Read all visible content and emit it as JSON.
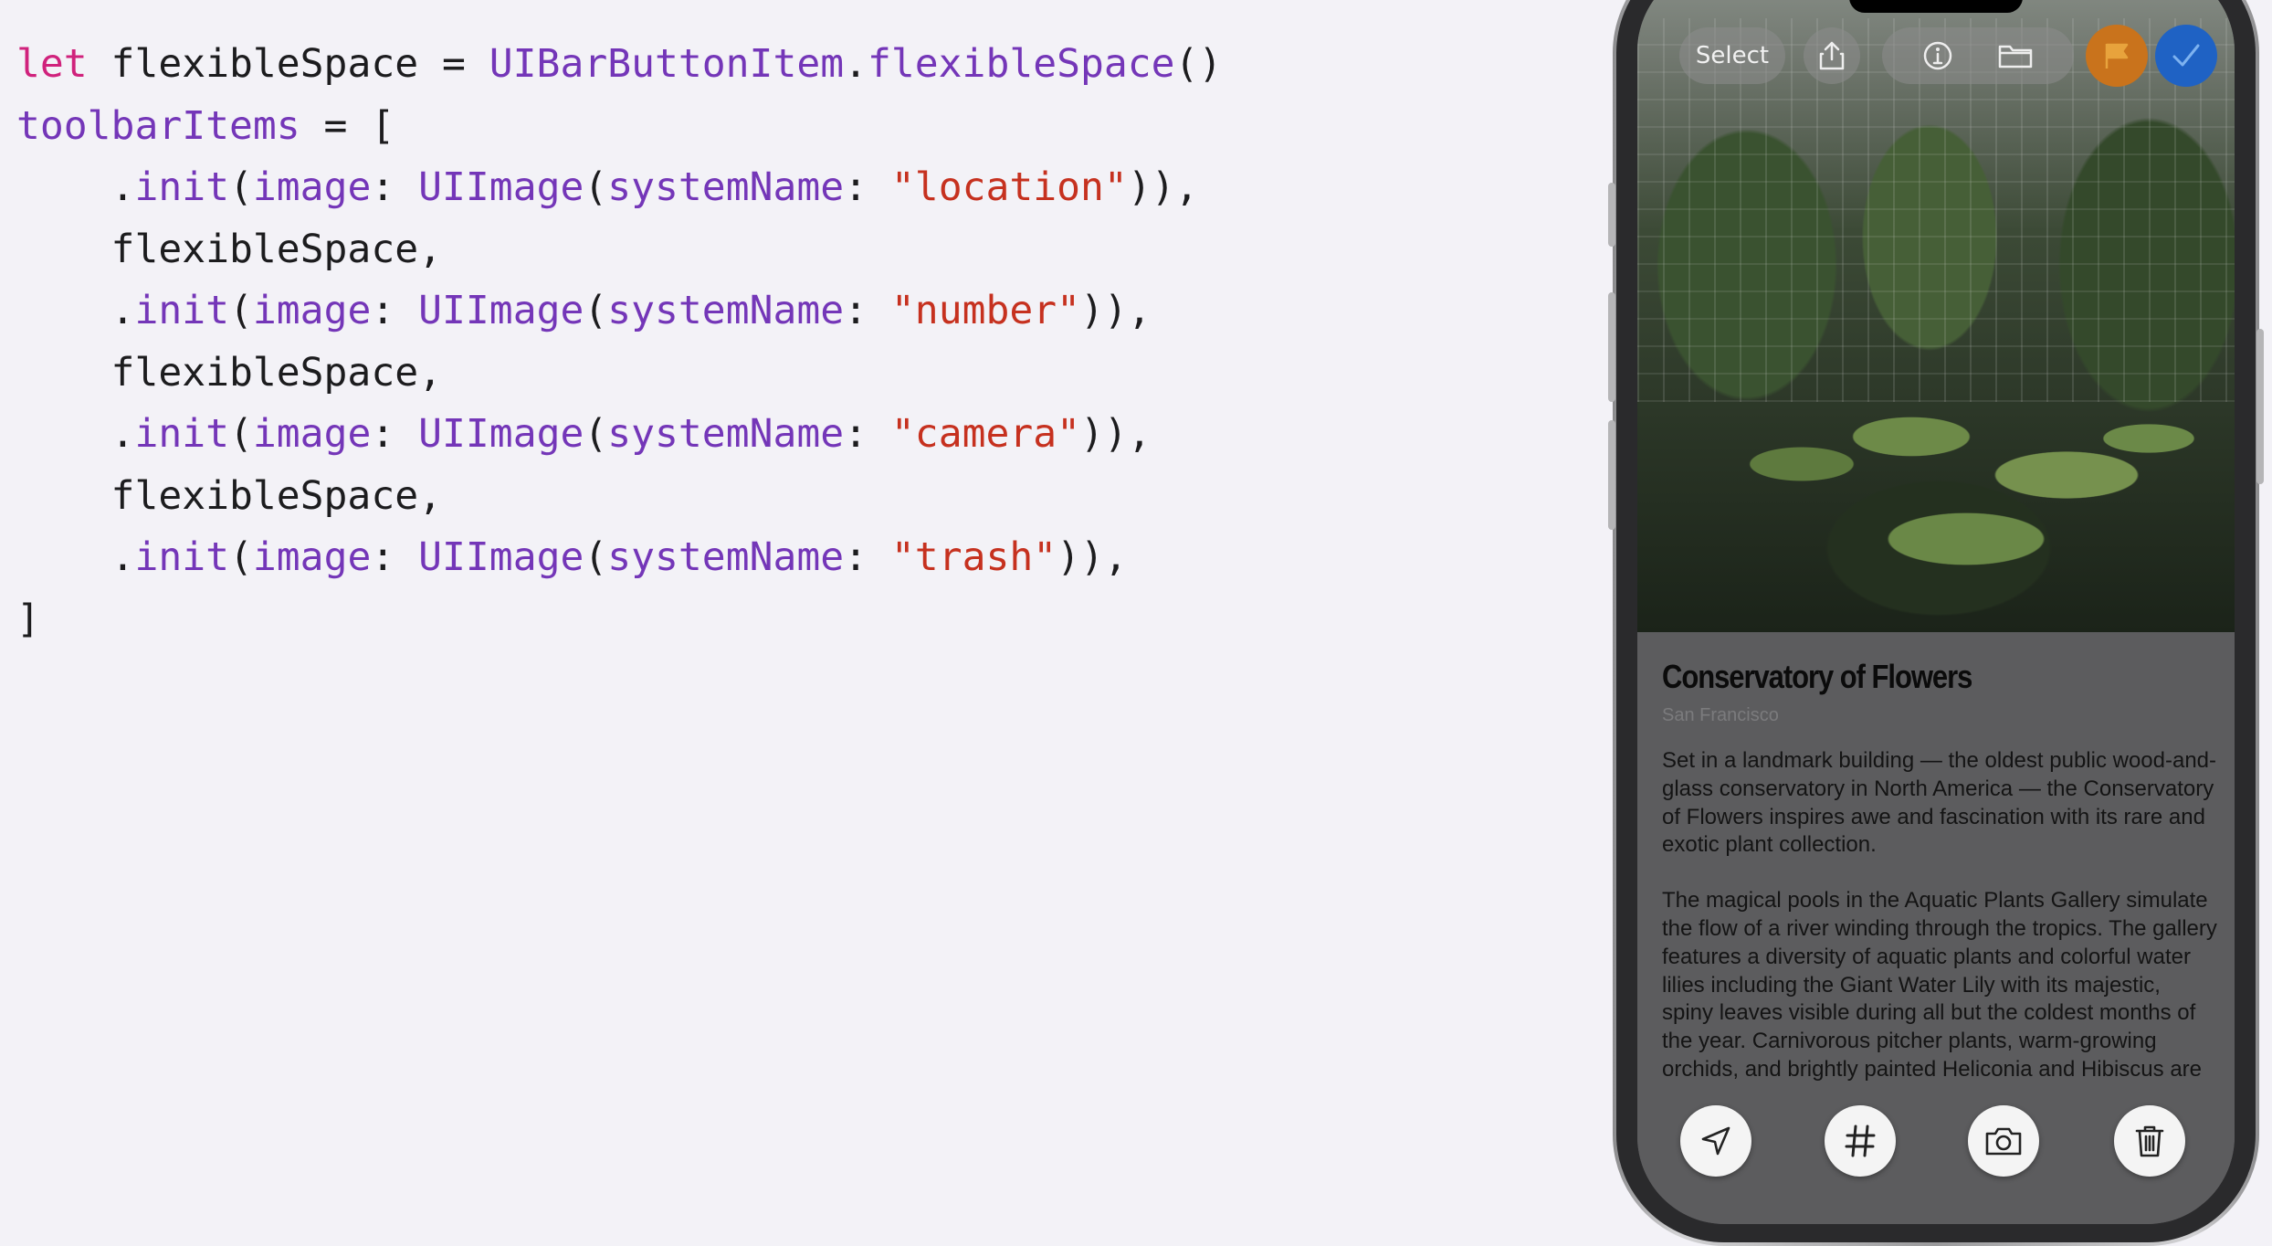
{
  "code_lines": [
    [
      {
        "t": "let",
        "c": "kw"
      },
      {
        "t": " flexibleSpace = ",
        "c": "pl"
      },
      {
        "t": "UIBarButtonItem",
        "c": "ty"
      },
      {
        "t": ".",
        "c": "pl"
      },
      {
        "t": "flexibleSpace",
        "c": "mb"
      },
      {
        "t": "()",
        "c": "pl"
      }
    ],
    [
      {
        "t": "toolbarItems",
        "c": "mb"
      },
      {
        "t": " = [",
        "c": "pl"
      }
    ],
    [
      {
        "t": "    .",
        "c": "pl"
      },
      {
        "t": "init",
        "c": "mb"
      },
      {
        "t": "(",
        "c": "pl"
      },
      {
        "t": "image",
        "c": "mb"
      },
      {
        "t": ": ",
        "c": "pl"
      },
      {
        "t": "UIImage",
        "c": "ty"
      },
      {
        "t": "(",
        "c": "pl"
      },
      {
        "t": "systemName",
        "c": "mb"
      },
      {
        "t": ": ",
        "c": "pl"
      },
      {
        "t": "\"location\"",
        "c": "st"
      },
      {
        "t": ")),",
        "c": "pl"
      }
    ],
    [
      {
        "t": "    flexibleSpace,",
        "c": "pl"
      }
    ],
    [
      {
        "t": "    .",
        "c": "pl"
      },
      {
        "t": "init",
        "c": "mb"
      },
      {
        "t": "(",
        "c": "pl"
      },
      {
        "t": "image",
        "c": "mb"
      },
      {
        "t": ": ",
        "c": "pl"
      },
      {
        "t": "UIImage",
        "c": "ty"
      },
      {
        "t": "(",
        "c": "pl"
      },
      {
        "t": "systemName",
        "c": "mb"
      },
      {
        "t": ": ",
        "c": "pl"
      },
      {
        "t": "\"number\"",
        "c": "st"
      },
      {
        "t": ")),",
        "c": "pl"
      }
    ],
    [
      {
        "t": "    flexibleSpace,",
        "c": "pl"
      }
    ],
    [
      {
        "t": "    .",
        "c": "pl"
      },
      {
        "t": "init",
        "c": "mb"
      },
      {
        "t": "(",
        "c": "pl"
      },
      {
        "t": "image",
        "c": "mb"
      },
      {
        "t": ": ",
        "c": "pl"
      },
      {
        "t": "UIImage",
        "c": "ty"
      },
      {
        "t": "(",
        "c": "pl"
      },
      {
        "t": "systemName",
        "c": "mb"
      },
      {
        "t": ": ",
        "c": "pl"
      },
      {
        "t": "\"camera\"",
        "c": "st"
      },
      {
        "t": ")),",
        "c": "pl"
      }
    ],
    [
      {
        "t": "    flexibleSpace,",
        "c": "pl"
      }
    ],
    [
      {
        "t": "    .",
        "c": "pl"
      },
      {
        "t": "init",
        "c": "mb"
      },
      {
        "t": "(",
        "c": "pl"
      },
      {
        "t": "image",
        "c": "mb"
      },
      {
        "t": ": ",
        "c": "pl"
      },
      {
        "t": "UIImage",
        "c": "ty"
      },
      {
        "t": "(",
        "c": "pl"
      },
      {
        "t": "systemName",
        "c": "mb"
      },
      {
        "t": ": ",
        "c": "pl"
      },
      {
        "t": "\"trash\"",
        "c": "st"
      },
      {
        "t": ")),",
        "c": "pl"
      }
    ],
    [
      {
        "t": "]",
        "c": "pl"
      }
    ]
  ],
  "colors": {
    "keyword": "#d0227c",
    "type": "#7436b8",
    "string": "#c6311f",
    "plain": "#1c1c1e",
    "flag_button": "#c9731c",
    "done_button": "#1f62c4"
  },
  "phone": {
    "top_bar": {
      "select_label": "Select",
      "icons": [
        "share-icon",
        "info-icon",
        "folder-icon",
        "flag-icon",
        "checkmark-icon"
      ]
    },
    "article": {
      "title": "Conservatory of Flowers",
      "subtitle": "San Francisco",
      "paragraphs": [
        "Set in a landmark building — the oldest public wood-and-glass conservatory in North America — the Conservatory of Flowers inspires awe and fascination with its rare and exotic plant collection.",
        "The magical pools in the Aquatic Plants Gallery simulate the flow of a river winding through the tropics. The gallery features a diversity of aquatic plants and colorful water lilies including the Giant Water Lily with its majestic, spiny leaves visible during all but the coldest months of the year. Carnivorous pitcher plants, warm-growing orchids, and brightly painted Heliconia and Hibiscus are"
      ]
    },
    "toolbar": {
      "icons": [
        "location-icon",
        "number-icon",
        "camera-icon",
        "trash-icon"
      ]
    }
  }
}
